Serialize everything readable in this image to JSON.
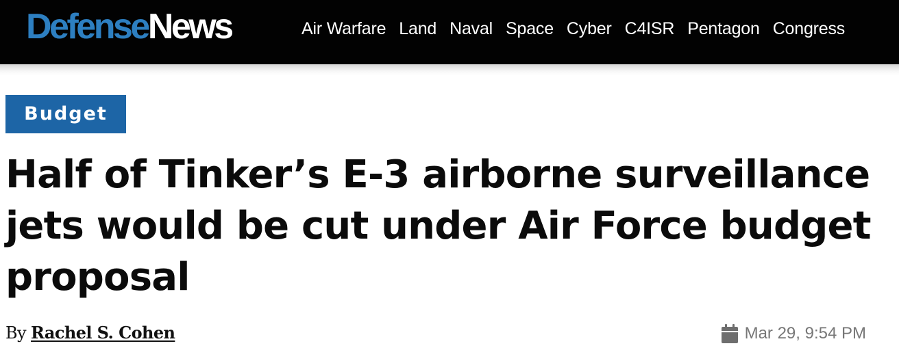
{
  "site": {
    "logo_part1": "Defense",
    "logo_part2": "News",
    "colors": {
      "logo_accent": "#2d7fc1",
      "header_bg": "#020202",
      "badge_bg": "#1d65a6"
    }
  },
  "nav": {
    "items": [
      "Air Warfare",
      "Land",
      "Naval",
      "Space",
      "Cyber",
      "C4ISR",
      "Pentagon",
      "Congress"
    ]
  },
  "article": {
    "category": "Budget",
    "headline": "Half of Tinker’s E-3 airborne surveillance jets would be cut under Air Force budget proposal",
    "byline_prefix": "By",
    "author": "Rachel S. Cohen",
    "date": "Mar 29, 9:54 PM",
    "date_icon": "calendar-icon"
  }
}
